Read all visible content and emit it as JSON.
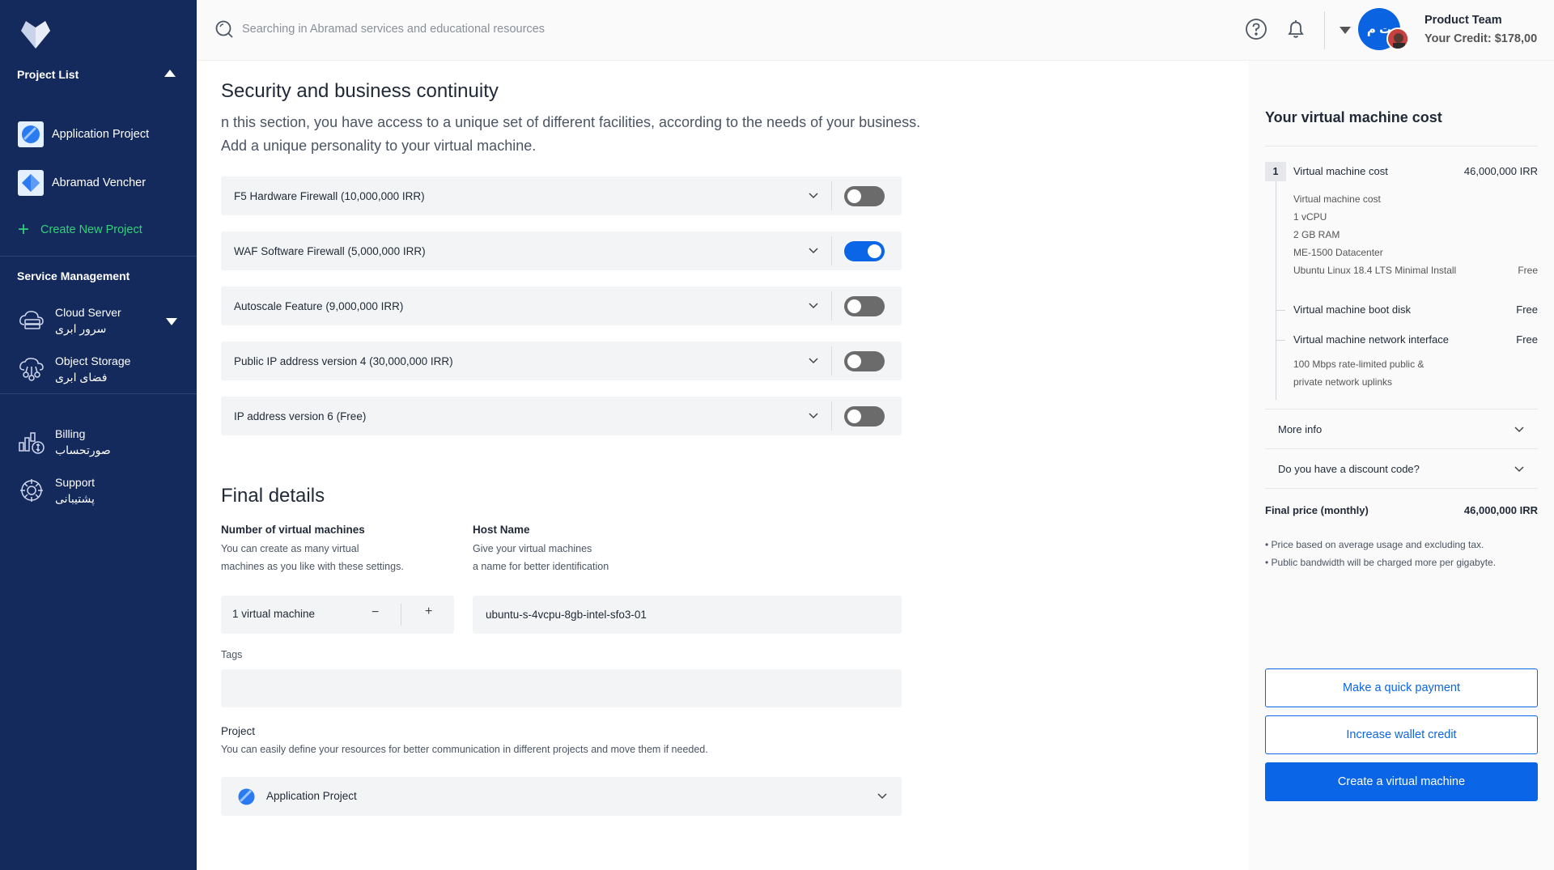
{
  "sidebar": {
    "project_list_title": "Project List",
    "projects": [
      {
        "label": "Application Project"
      },
      {
        "label": "Abramad Vencher"
      }
    ],
    "create_project_label": "Create New Project",
    "service_management_title": "Service Management",
    "services": [
      {
        "label": "Cloud Server",
        "label_fa": "سرور ابری"
      },
      {
        "label": "Object Storage",
        "label_fa": "فضای ابری"
      }
    ],
    "extras": [
      {
        "label": "Billing",
        "label_fa": "صورتحساب"
      },
      {
        "label": "Support",
        "label_fa": "پشتیبانی"
      }
    ]
  },
  "header": {
    "search_placeholder": "Searching in Abramad services and educational resources",
    "avatar_initials": "ت م",
    "account_name": "Product Team",
    "account_credit": "Your Credit: $178,00"
  },
  "security": {
    "title": "Security and business continuity",
    "desc_line1": "n this section, you have access to a unique set of different facilities, according to the needs of your business.",
    "desc_line2": "Add a unique personality to your virtual machine.",
    "features": [
      {
        "label": "F5 Hardware Firewall  (10,000,000 IRR)",
        "enabled": false
      },
      {
        "label": "WAF Software Firewall  (5,000,000 IRR)",
        "enabled": true
      },
      {
        "label": "Autoscale Feature  (9,000,000 IRR)",
        "enabled": false
      },
      {
        "label": "Public IP address version 4  (30,000,000 IRR)",
        "enabled": false
      },
      {
        "label": "IP address version 6  (Free)",
        "enabled": false
      }
    ]
  },
  "final_details": {
    "title": "Final details",
    "vm_count_label": "Number of virtual machines",
    "vm_count_help1": "You can create as many virtual",
    "vm_count_help2": "machines as you like with these settings.",
    "vm_count_value": "1 virtual machine",
    "minus": "−",
    "plus": "+",
    "host_label": "Host Name",
    "host_help1": "Give your virtual machines",
    "host_help2": "a name for better identification",
    "host_value": "ubuntu-s-4vcpu-8gb-intel-sfo3-01",
    "tags_label": "Tags",
    "project_label": "Project",
    "project_help": "You can easily define your resources for better communication in different projects and move them if needed.",
    "project_value": "Application Project"
  },
  "cost_panel": {
    "title": "Your virtual machine cost",
    "step_number": "1",
    "vm_cost_label": "Virtual machine cost",
    "vm_cost_value": "46,000,000 IRR",
    "specs": [
      "Virtual machine cost",
      "1 vCPU",
      "2 GB RAM",
      "ME-1500 Datacenter",
      "Ubuntu Linux 18.4 LTS Minimal Install"
    ],
    "specs_price": "Free",
    "boot_disk_label": "Virtual machine boot disk",
    "boot_disk_value": "Free",
    "network_label": "Virtual machine network interface",
    "network_value": "Free",
    "network_desc1": "100 Mbps rate-limited public &",
    "network_desc2": "private network uplinks",
    "more_info": "More info",
    "discount": "Do you have a discount code?",
    "final_label": "Final price (monthly)",
    "final_value": "46,000,000 IRR",
    "note1": "• Price based on average usage and excluding tax.",
    "note2": "• Public bandwidth will be charged more per gigabyte.",
    "btn_quick_pay": "Make a quick payment",
    "btn_wallet": "Increase wallet credit",
    "btn_create": "Create a virtual machine"
  },
  "colors": {
    "sidebar_bg": "#142a5c",
    "accent": "#0a66e6",
    "create_green": "#33d17a"
  }
}
